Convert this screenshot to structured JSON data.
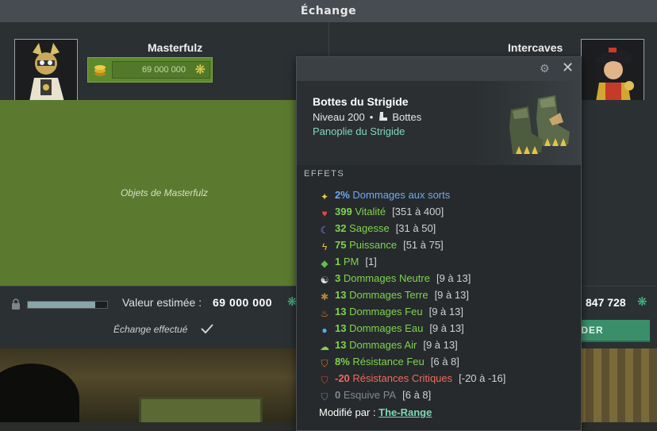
{
  "window": {
    "title": "Échange"
  },
  "left_player": {
    "name": "Masterfulz",
    "kamas": "69 000 000",
    "objects_label": "Objets de Masterfulz"
  },
  "right_player": {
    "name": "Intercaves"
  },
  "bottom": {
    "estimated_label": "Valeur estimée :",
    "estimated_value": "69 000 000",
    "status": "Échange effectué",
    "right_value": "847 728",
    "validate_label": "IDER",
    "progress_fraction": 0.85
  },
  "tooltip": {
    "item_name": "Bottes du Strigide",
    "level": "Niveau 200",
    "type": "Bottes",
    "set_name": "Panoplie du Strigide",
    "effects_title": "EFFETS",
    "effects": [
      {
        "icon": "star-icon",
        "value": "2%",
        "name": "Dommages aux sorts",
        "range": "",
        "color": "#6fa8f5"
      },
      {
        "icon": "heart-icon",
        "value": "399",
        "name": "Vitalité",
        "range": "[351 à 400]",
        "color": "#7fd34e"
      },
      {
        "icon": "moon-icon",
        "value": "32",
        "name": "Sagesse",
        "range": "[31 à 50]",
        "color": "#7fd34e"
      },
      {
        "icon": "lightning-icon",
        "value": "75",
        "name": "Puissance",
        "range": "[51 à 75]",
        "color": "#7fd34e"
      },
      {
        "icon": "pm-icon",
        "value": "1",
        "name": "PM",
        "range": "[1]",
        "color": "#7fd34e"
      },
      {
        "icon": "yinyang-icon",
        "value": "3",
        "name": "Dommages Neutre",
        "range": "[9 à 13]",
        "color": "#7fd34e"
      },
      {
        "icon": "earth-icon",
        "value": "13",
        "name": "Dommages Terre",
        "range": "[9 à 13]",
        "color": "#7fd34e"
      },
      {
        "icon": "fire-icon",
        "value": "13",
        "name": "Dommages Feu",
        "range": "[9 à 13]",
        "color": "#7fd34e"
      },
      {
        "icon": "water-icon",
        "value": "13",
        "name": "Dommages Eau",
        "range": "[9 à 13]",
        "color": "#7fd34e"
      },
      {
        "icon": "air-icon",
        "value": "13",
        "name": "Dommages Air",
        "range": "[9 à 13]",
        "color": "#7fd34e"
      },
      {
        "icon": "fire-shield-icon",
        "value": "8%",
        "name": "Résistance Feu",
        "range": "[6 à 8]",
        "color": "#7fd34e"
      },
      {
        "icon": "crit-shield-icon",
        "value": "-20",
        "name": "Résistances Critiques",
        "range": "[-20 à -16]",
        "color": "#f06a5e"
      },
      {
        "icon": "dodge-shield-icon",
        "value": "0",
        "name": "Esquive PA",
        "range": "[6 à 8]",
        "color": "#7f8a90"
      }
    ],
    "modified_label": "Modifié par :",
    "modified_by": "The-Range"
  },
  "colors": {
    "accent_green": "#7fd34e",
    "kama": "#3fc28a",
    "panel_green": "#5b7a2f"
  }
}
